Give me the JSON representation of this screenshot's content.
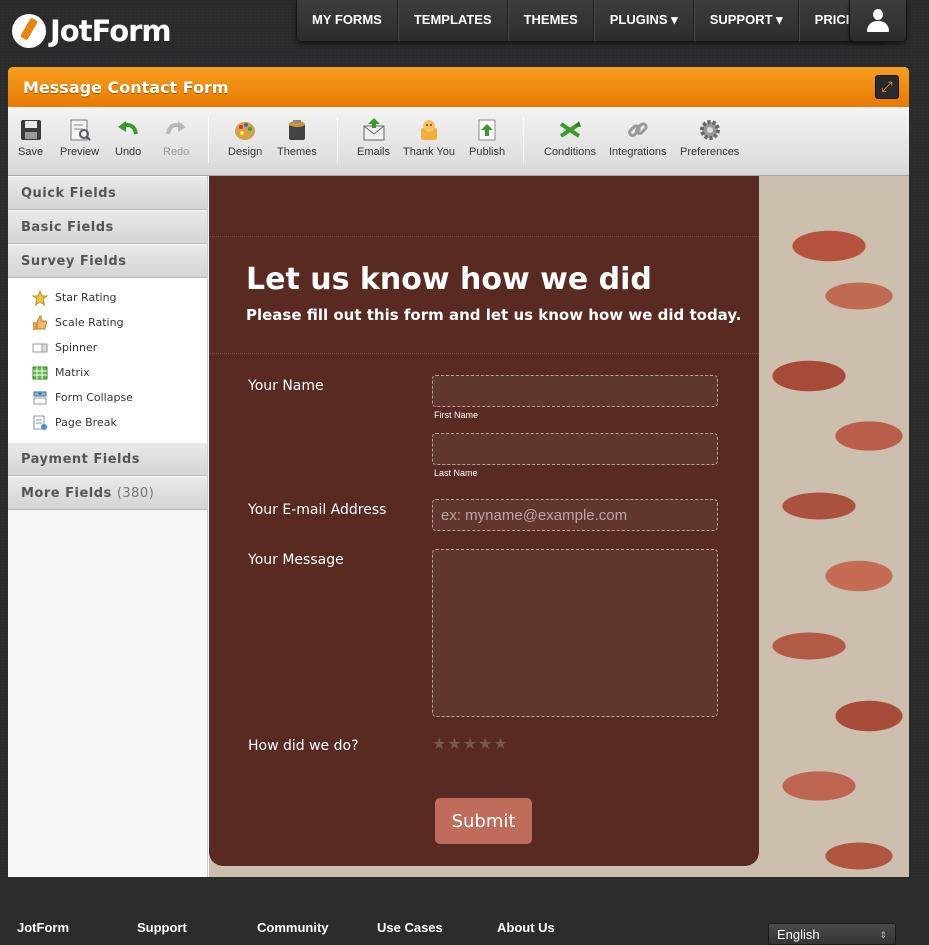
{
  "brand": {
    "name": "JotForm"
  },
  "topnav": {
    "items": [
      "MY FORMS",
      "TEMPLATES",
      "THEMES",
      "PLUGINS ▾",
      "SUPPORT ▾",
      "PRICING"
    ]
  },
  "window": {
    "title": "Message Contact Form"
  },
  "toolbar": {
    "save": "Save",
    "preview": "Preview",
    "undo": "Undo",
    "redo": "Redo",
    "design": "Design",
    "themes": "Themes",
    "emails": "Emails",
    "thankyou": "Thank You",
    "publish": "Publish",
    "conditions": "Conditions",
    "integrations": "Integrations",
    "preferences": "Preferences"
  },
  "sidebar": {
    "quick": "Quick Fields",
    "basic": "Basic Fields",
    "survey": "Survey Fields",
    "survey_items": [
      "Star Rating",
      "Scale Rating",
      "Spinner",
      "Matrix",
      "Form Collapse",
      "Page Break"
    ],
    "payment": "Payment Fields",
    "more": "More Fields",
    "more_count": "(380)"
  },
  "form": {
    "title": "Let us know how we did",
    "subtitle": "Please fill out this form and let us know how we did today.",
    "name_label": "Your Name",
    "first_name": "First Name",
    "last_name": "Last Name",
    "email_label": "Your E-mail Address",
    "email_placeholder": "ex: myname@example.com",
    "message_label": "Your Message",
    "rating_label": "How did we do?",
    "rating_value": 0,
    "rating_max": 5,
    "submit": "Submit"
  },
  "footer": {
    "links": [
      "JotForm",
      "Support",
      "Community",
      "Use Cases",
      "About Us"
    ],
    "language": "English"
  }
}
